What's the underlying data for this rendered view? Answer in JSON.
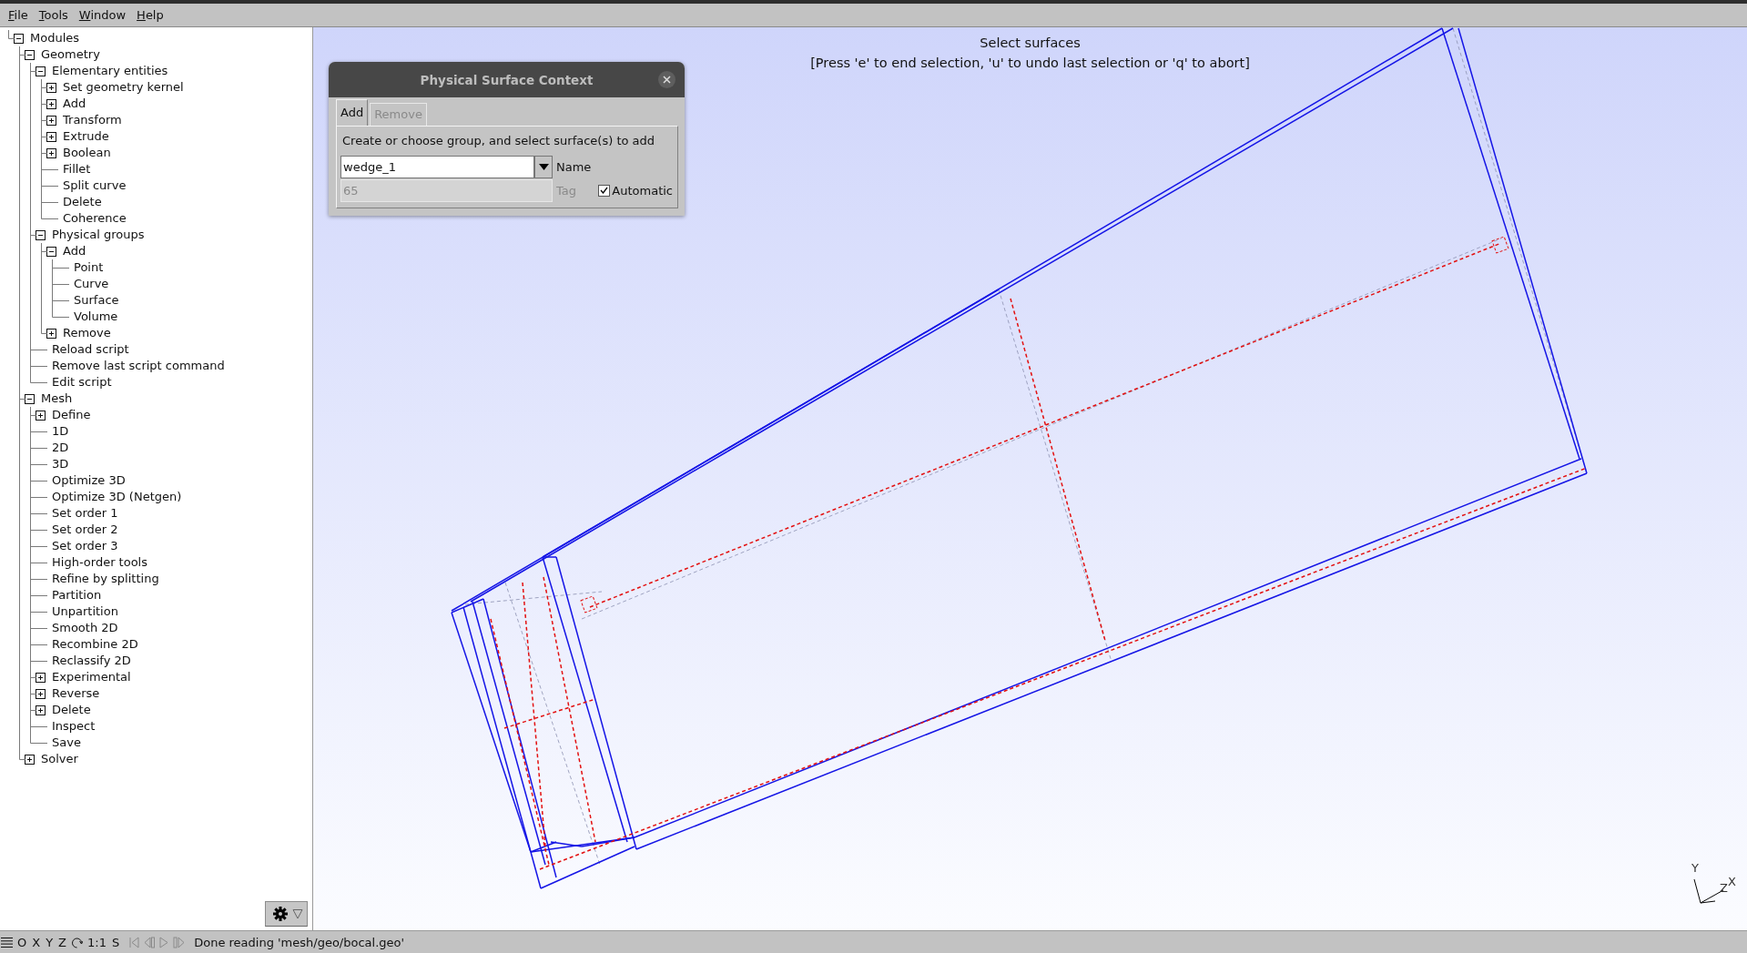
{
  "menu": [
    "File",
    "Tools",
    "Window",
    "Help"
  ],
  "tree": [
    {
      "label": "Modules",
      "expanded": true,
      "children": [
        {
          "label": "Geometry",
          "expanded": true,
          "children": [
            {
              "label": "Elementary entities",
              "expanded": true,
              "children": [
                {
                  "label": "Set geometry kernel",
                  "expanded": false
                },
                {
                  "label": "Add",
                  "expanded": false
                },
                {
                  "label": "Transform",
                  "expanded": false
                },
                {
                  "label": "Extrude",
                  "expanded": false
                },
                {
                  "label": "Boolean",
                  "expanded": false
                },
                {
                  "label": "Fillet"
                },
                {
                  "label": "Split curve"
                },
                {
                  "label": "Delete"
                },
                {
                  "label": "Coherence"
                }
              ]
            },
            {
              "label": "Physical groups",
              "expanded": true,
              "children": [
                {
                  "label": "Add",
                  "expanded": true,
                  "children": [
                    {
                      "label": "Point"
                    },
                    {
                      "label": "Curve"
                    },
                    {
                      "label": "Surface"
                    },
                    {
                      "label": "Volume"
                    }
                  ]
                },
                {
                  "label": "Remove",
                  "expanded": false
                }
              ]
            },
            {
              "label": "Reload script"
            },
            {
              "label": "Remove last script command"
            },
            {
              "label": "Edit script"
            }
          ]
        },
        {
          "label": "Mesh",
          "expanded": true,
          "children": [
            {
              "label": "Define",
              "expanded": false
            },
            {
              "label": "1D"
            },
            {
              "label": "2D"
            },
            {
              "label": "3D"
            },
            {
              "label": "Optimize 3D"
            },
            {
              "label": "Optimize 3D (Netgen)"
            },
            {
              "label": "Set order 1"
            },
            {
              "label": "Set order 2"
            },
            {
              "label": "Set order 3"
            },
            {
              "label": "High-order tools"
            },
            {
              "label": "Refine by splitting"
            },
            {
              "label": "Partition"
            },
            {
              "label": "Unpartition"
            },
            {
              "label": "Smooth 2D"
            },
            {
              "label": "Recombine 2D"
            },
            {
              "label": "Reclassify 2D"
            },
            {
              "label": "Experimental",
              "expanded": false
            },
            {
              "label": "Reverse",
              "expanded": false
            },
            {
              "label": "Delete",
              "expanded": false
            },
            {
              "label": "Inspect"
            },
            {
              "label": "Save"
            }
          ]
        },
        {
          "label": "Solver",
          "expanded": false
        }
      ]
    }
  ],
  "viewport": {
    "prompt": "Select surfaces",
    "hint": "[Press 'e' to end selection, 'u' to undo last selection or 'q' to abort]",
    "axes": {
      "y": "Y",
      "z": "Z",
      "x": "X"
    }
  },
  "dialog": {
    "title": "Physical Surface Context",
    "tabs": [
      {
        "label": "Add",
        "selected": true
      },
      {
        "label": "Remove",
        "selected": false
      }
    ],
    "instruction": "Create or choose group, and select surface(s) to add",
    "name_field": {
      "value": "wedge_1",
      "label": "Name"
    },
    "tag_field": {
      "value": "65",
      "label": "Tag",
      "disabled": true
    },
    "automatic": {
      "label": "Automatic",
      "checked": true
    }
  },
  "status_bar": {
    "view_buttons": [
      "O",
      "X",
      "Y",
      "Z"
    ],
    "scale": "1:1",
    "s": "S",
    "message": "Done reading 'mesh/geo/bocal.geo'"
  }
}
